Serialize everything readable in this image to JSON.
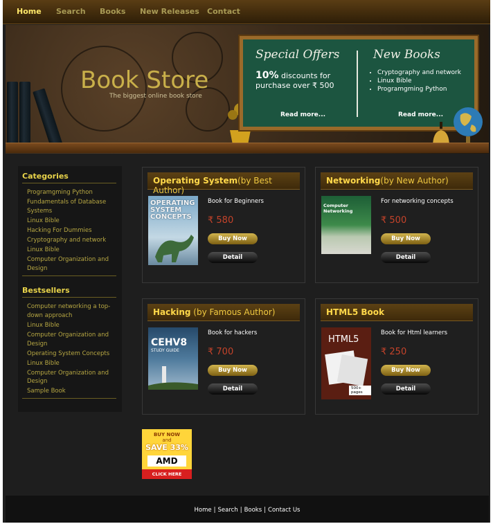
{
  "nav": {
    "items": [
      {
        "label": "Home",
        "active": true
      },
      {
        "label": "Search"
      },
      {
        "label": "Books"
      },
      {
        "label": "New Releases"
      },
      {
        "label": "Contact"
      }
    ]
  },
  "header": {
    "title": "Book Store",
    "tagline": "The biggest online book store",
    "board": {
      "offers_heading": "Special Offers",
      "offer_highlight": "10%",
      "offer_text": "discounts for purchase over ₹ 500",
      "offers_read_more": "Read more...",
      "new_heading": "New Books",
      "new_items": [
        "Cryptography and network",
        "Linux Bible",
        "Programgming Python"
      ],
      "new_read_more": "Read more..."
    }
  },
  "sidebar": {
    "categories_heading": "Categories",
    "categories": [
      "Programgming Python",
      "Fundamentals of Database Systems",
      "Linux Bible",
      "Hacking For Dummies",
      "Cryptography and network",
      "Linux Bible",
      "Computer Organization and Design"
    ],
    "bestsellers_heading": "Bestsellers",
    "bestsellers": [
      "Computer networking a top-down approach",
      "Linux Bible",
      "Computer Organization and Design",
      "Operating System Concepts",
      "Linux Bible",
      "Computer Organization and Design",
      "Sample Book"
    ]
  },
  "products": [
    {
      "title": "Operating System",
      "subtitle": "(by Best Author)",
      "description": "Book for Beginners",
      "price": "₹ 580",
      "buy_label": "Buy Now",
      "detail_label": "Detail",
      "cover_text": [
        "OPERATING",
        "SYSTEM",
        "CONCEPTS"
      ]
    },
    {
      "title": "Networking",
      "subtitle": "(by New Author)",
      "description": "For networking concepts",
      "price": "₹ 500",
      "buy_label": "Buy Now",
      "detail_label": "Detail",
      "cover_text": [
        "Computer Networking"
      ]
    },
    {
      "title": "Hacking",
      "subtitle": " (by Famous Author)",
      "description": "Book for hackers",
      "price": "₹ 700",
      "buy_label": "Buy Now",
      "detail_label": "Detail",
      "cover_text": [
        "CEHV8",
        "STUDY GUIDE"
      ]
    },
    {
      "title": "HTML5 Book",
      "subtitle": "",
      "description": "Book for Html learners",
      "price": "₹ 250",
      "buy_label": "Buy Now",
      "detail_label": "Detail",
      "cover_text": [
        "HTML5",
        "500+ pages"
      ]
    }
  ],
  "ad": {
    "line1": "BUY NOW",
    "line2": "and",
    "line3": "SAVE 33%",
    "brand": "AMD",
    "cta": "CLICK HERE"
  },
  "footer": {
    "links": [
      "Home",
      "Search",
      "Books",
      "Contact Us"
    ]
  },
  "colors": {
    "accent_gold": "#e8d34a",
    "price_red": "#c5432a",
    "board_green": "#1c5540"
  }
}
